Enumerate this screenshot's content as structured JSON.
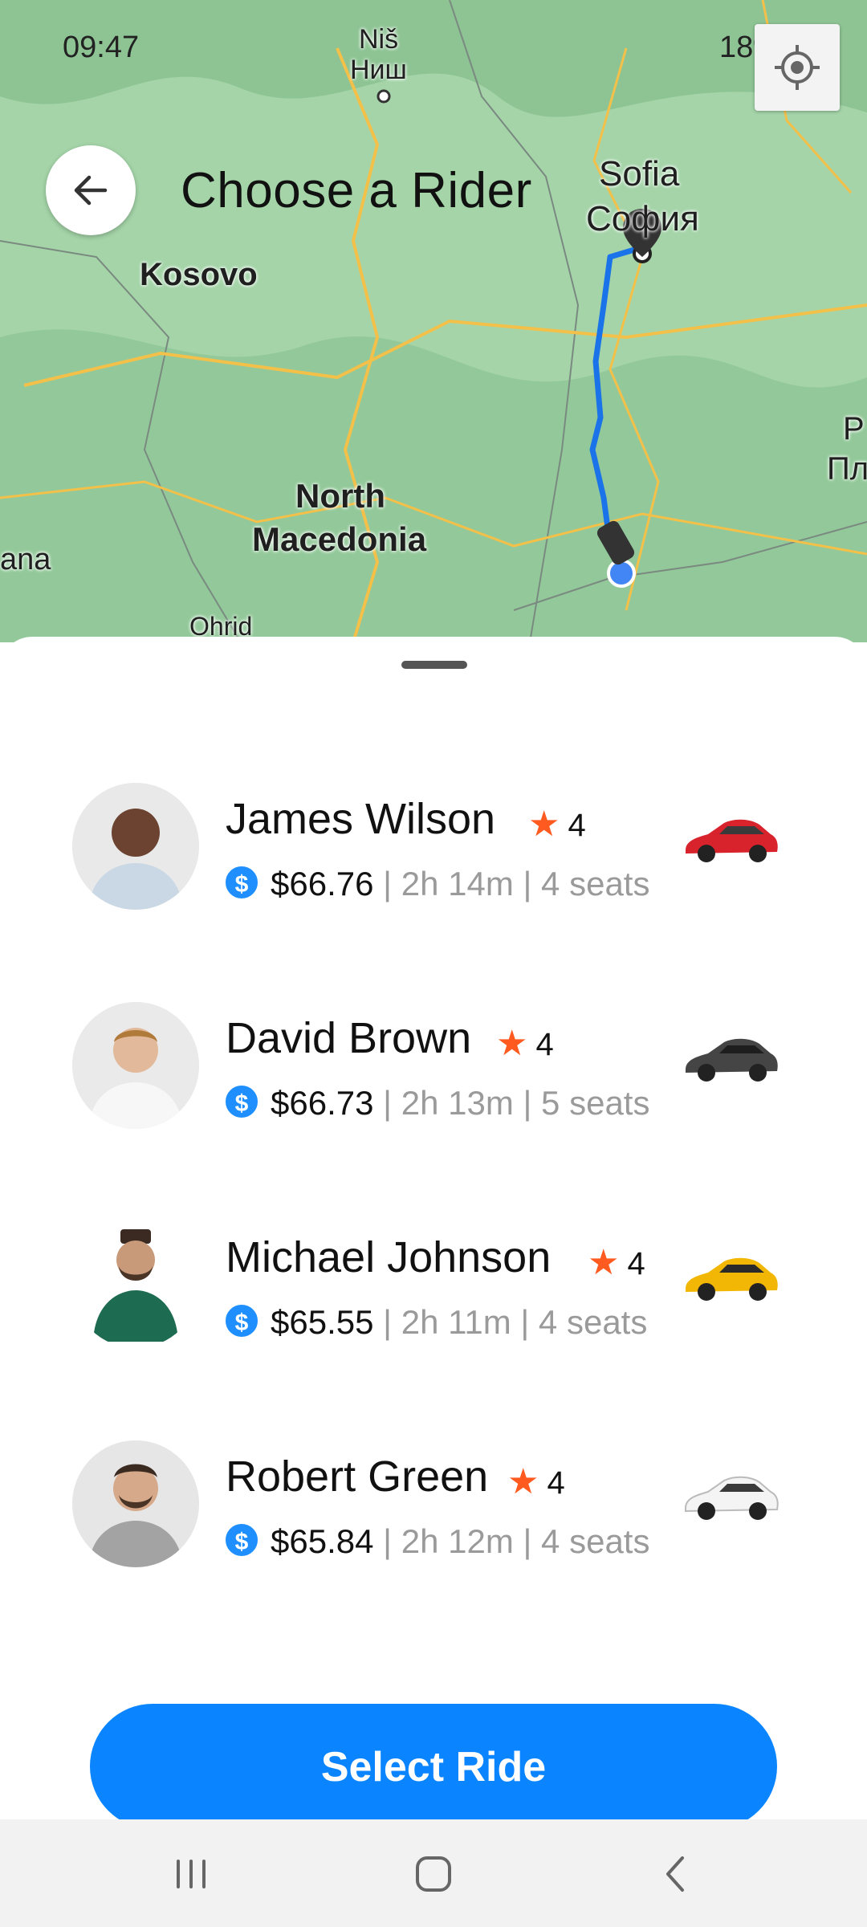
{
  "status_bar": {
    "time": "09:47",
    "battery": "18%"
  },
  "header": {
    "title": "Choose a Rider"
  },
  "map": {
    "labels": [
      "Niš",
      "Ниш",
      "Sofia",
      "София",
      "Kosovo",
      "North",
      "Macedonia",
      "Ohrid",
      "ana",
      "P",
      "Пл"
    ]
  },
  "riders": [
    {
      "name": "James Wilson",
      "rating": "4",
      "price": "$66.76",
      "meta": " | 2h 14m | 4 seats",
      "car_color": "#d8222c"
    },
    {
      "name": "David Brown",
      "rating": "4",
      "price": "$66.73",
      "meta": " | 2h 13m | 5 seats",
      "car_color": "#444444"
    },
    {
      "name": "Michael Johnson",
      "rating": "4",
      "price": "$65.55",
      "meta": " | 2h 11m | 4 seats",
      "car_color": "#f2b705"
    },
    {
      "name": "Robert Green",
      "rating": "4",
      "price": "$65.84",
      "meta": " | 2h 12m | 4 seats",
      "car_color": "#f4f4f4"
    }
  ],
  "icons": {
    "star": "★",
    "dollar": "$"
  },
  "actions": {
    "select_label": "Select Ride"
  },
  "colors": {
    "accent": "#0a84ff",
    "star": "#ff5a1f",
    "route": "#1a73e8"
  }
}
